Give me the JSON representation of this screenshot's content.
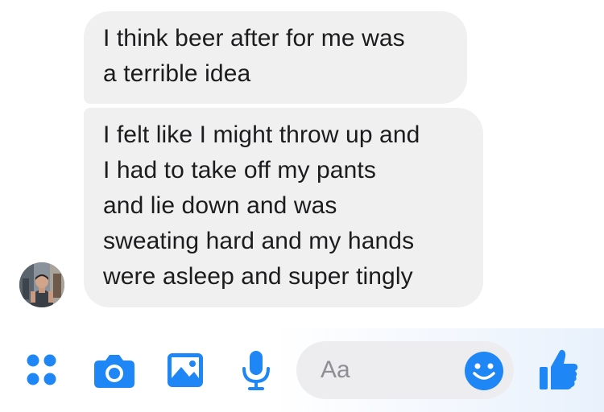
{
  "messages": [
    {
      "sender": "contact",
      "lines": [
        "I think beer after for me was",
        "a terrible idea"
      ]
    },
    {
      "sender": "contact",
      "lines": [
        "I felt like I might throw up and",
        "I had to take off my pants",
        "and lie down and was",
        "sweating hard and my hands",
        "were asleep and super tingly"
      ]
    }
  ],
  "composer": {
    "placeholder": "Aa",
    "icons": [
      "more-apps-icon",
      "camera-icon",
      "photo-icon",
      "microphone-icon",
      "emoji-icon",
      "thumbs-up-icon"
    ],
    "accent_color": "#1e86f5"
  },
  "colors": {
    "bubble_bg": "#f0f0f0",
    "text": "#1c1c1e",
    "input_bg": "#ededf0",
    "placeholder": "#8e8e93"
  }
}
